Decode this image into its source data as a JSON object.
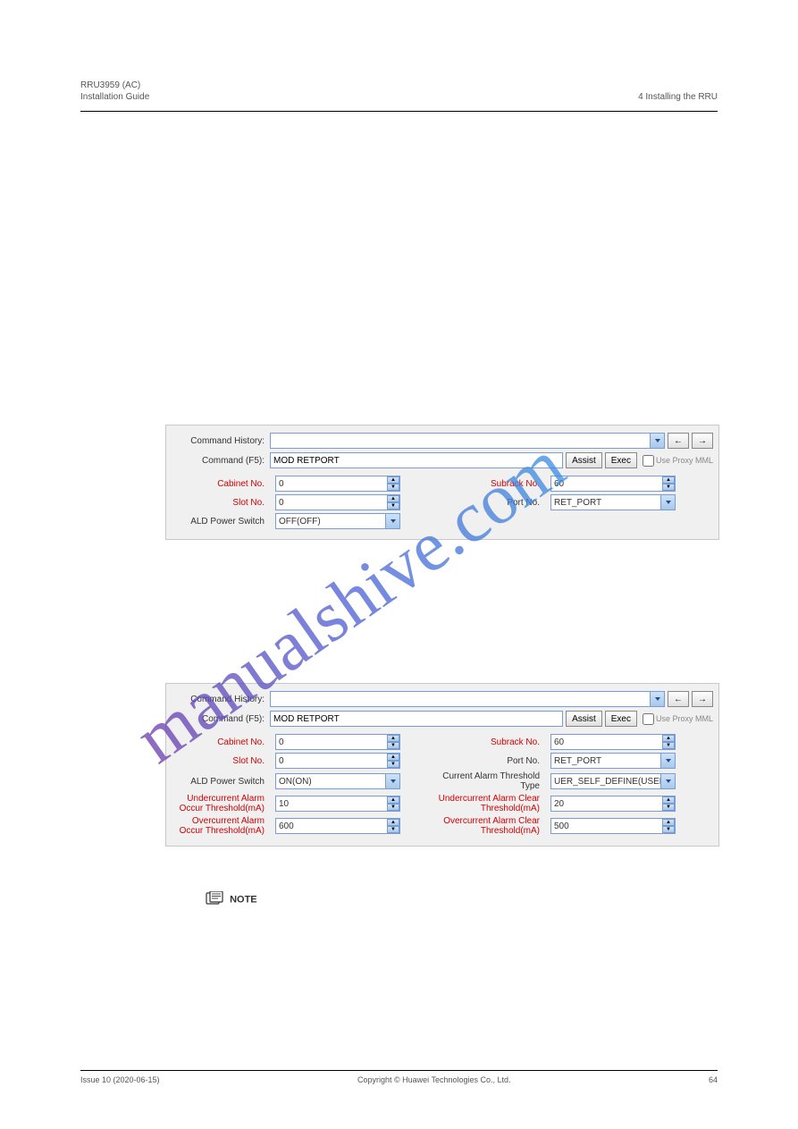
{
  "header": {
    "left1": "RRU3959 (AC)",
    "left2": "Installation Guide",
    "right": "4 Installing the RRU"
  },
  "note": {
    "label": "NOTE"
  },
  "watermark": "manualshive.com",
  "panel1": {
    "history_label": "Command History:",
    "command_label": "Command (F5):",
    "command_value": "MOD RETPORT",
    "btn_prev": "←",
    "btn_next": "→",
    "btn_assist": "Assist",
    "btn_exec": "Exec",
    "use_proxy": "Use Proxy MML",
    "fields": {
      "cabinet_label": "Cabinet No.",
      "cabinet_value": "0",
      "subrack_label": "Subrack No.",
      "subrack_value": "60",
      "slot_label": "Slot No.",
      "slot_value": "0",
      "port_label": "Port No.",
      "port_value": "RET_PORT",
      "ald_label": "ALD Power Switch",
      "ald_value": "OFF(OFF)"
    }
  },
  "panel2": {
    "history_label": "Command History:",
    "command_label": "Command (F5):",
    "command_value": "MOD RETPORT",
    "btn_prev": "←",
    "btn_next": "→",
    "btn_assist": "Assist",
    "btn_exec": "Exec",
    "use_proxy": "Use Proxy MML",
    "fields": {
      "cabinet_label": "Cabinet No.",
      "cabinet_value": "0",
      "subrack_label": "Subrack No.",
      "subrack_value": "60",
      "slot_label": "Slot No.",
      "slot_value": "0",
      "port_label": "Port No.",
      "port_value": "RET_PORT",
      "ald_label": "ALD Power Switch",
      "ald_value": "ON(ON)",
      "cat_label": "Current Alarm Threshold Type",
      "cat_value": "UER_SELF_DEFINE(USER_",
      "uc_occur_label": "Undercurrent Alarm Occur Threshold(mA)",
      "uc_occur_value": "10",
      "uc_clear_label": "Undercurrent Alarm Clear Threshold(mA)",
      "uc_clear_value": "20",
      "oc_occur_label": "Overcurrent Alarm Occur Threshold(mA)",
      "oc_occur_value": "600",
      "oc_clear_label": "Overcurrent Alarm Clear Threshold(mA)",
      "oc_clear_value": "500"
    }
  },
  "footer": {
    "left1": "Issue 10 (2020-06-15)",
    "center": "Copyright © Huawei Technologies Co., Ltd.",
    "right": "64"
  }
}
